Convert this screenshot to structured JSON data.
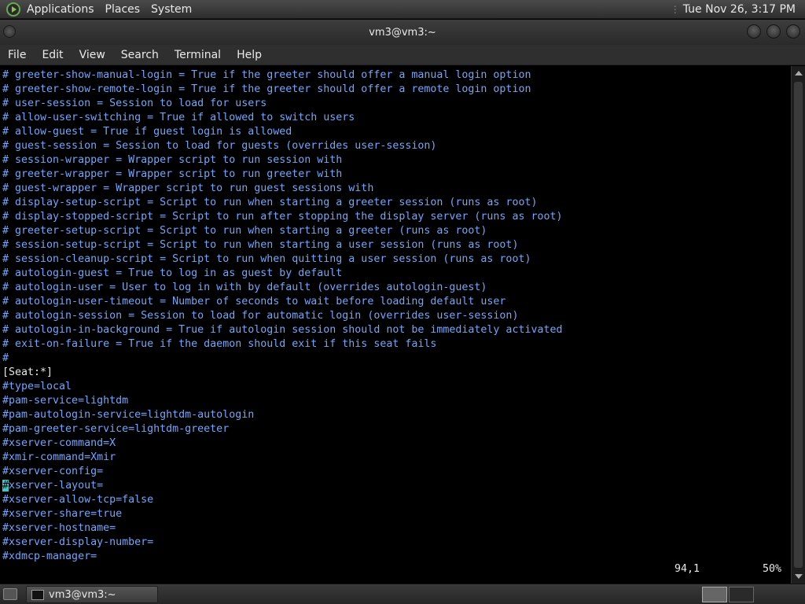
{
  "top_panel": {
    "menus": [
      "Applications",
      "Places",
      "System"
    ],
    "clock": "Tue Nov 26,  3:17 PM"
  },
  "window": {
    "title": "vm3@vm3:~"
  },
  "menubar": [
    "File",
    "Edit",
    "View",
    "Search",
    "Terminal",
    "Help"
  ],
  "terminal": {
    "lines": [
      "# greeter-show-manual-login = True if the greeter should offer a manual login option",
      "# greeter-show-remote-login = True if the greeter should offer a remote login option",
      "# user-session = Session to load for users",
      "# allow-user-switching = True if allowed to switch users",
      "# allow-guest = True if guest login is allowed",
      "# guest-session = Session to load for guests (overrides user-session)",
      "# session-wrapper = Wrapper script to run session with",
      "# greeter-wrapper = Wrapper script to run greeter with",
      "# guest-wrapper = Wrapper script to run guest sessions with",
      "# display-setup-script = Script to run when starting a greeter session (runs as root)",
      "# display-stopped-script = Script to run after stopping the display server (runs as root)",
      "# greeter-setup-script = Script to run when starting a greeter (runs as root)",
      "# session-setup-script = Script to run when starting a user session (runs as root)",
      "# session-cleanup-script = Script to run when quitting a user session (runs as root)",
      "# autologin-guest = True to log in as guest by default",
      "# autologin-user = User to log in with by default (overrides autologin-guest)",
      "# autologin-user-timeout = Number of seconds to wait before loading default user",
      "# autologin-session = Session to load for automatic login (overrides user-session)",
      "# autologin-in-background = True if autologin session should not be immediately activated",
      "# exit-on-failure = True if the daemon should exit if this seat fails",
      "#"
    ],
    "section": "[Seat:*]",
    "config_lines_before": [
      "#type=local",
      "#pam-service=lightdm",
      "#pam-autologin-service=lightdm-autologin",
      "#pam-greeter-service=lightdm-greeter",
      "#xserver-command=X",
      "#xmir-command=Xmir",
      "#xserver-config="
    ],
    "cursor_line": {
      "cursor_char": "#",
      "rest": "xserver-layout="
    },
    "config_lines_after": [
      "#xserver-allow-tcp=false",
      "#xserver-share=true",
      "#xserver-hostname=",
      "#xserver-display-number=",
      "#xdmcp-manager="
    ],
    "status_position": "94,1",
    "status_percent": "50%"
  },
  "taskbar": {
    "task_label": "vm3@vm3:~"
  }
}
